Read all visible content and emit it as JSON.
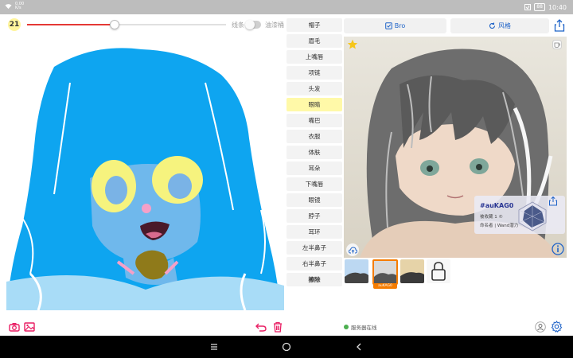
{
  "status_bar": {
    "left_line1": "0.00",
    "left_line2": "K/s",
    "battery": "88",
    "time": "10:40"
  },
  "drawing": {
    "brush_size": "21",
    "slider_fraction": 0.44,
    "slider_color": "#e53935",
    "mode_line": "线条",
    "mode_fill": "油漆桶",
    "brush_color": "#0ea5f0"
  },
  "left_toolbar": {
    "icons": [
      "camera-icon",
      "image-icon",
      "undo-icon",
      "trash-icon"
    ],
    "accent": "#e91e63"
  },
  "parts": [
    {
      "label": "帽子",
      "active": false
    },
    {
      "label": "眉毛",
      "active": false
    },
    {
      "label": "上嘴唇",
      "active": false
    },
    {
      "label": "项链",
      "active": false
    },
    {
      "label": "头发",
      "active": false
    },
    {
      "label": "眼睛",
      "active": true
    },
    {
      "label": "嘴巴",
      "active": false
    },
    {
      "label": "衣服",
      "active": false
    },
    {
      "label": "体肤",
      "active": false
    },
    {
      "label": "耳朵",
      "active": false
    },
    {
      "label": "下嘴唇",
      "active": false
    },
    {
      "label": "眼镜",
      "active": false
    },
    {
      "label": "脖子",
      "active": false
    },
    {
      "label": "耳环",
      "active": false
    },
    {
      "label": "左半鼻子",
      "active": false
    },
    {
      "label": "右半鼻子",
      "active": false
    },
    {
      "label": "擦除",
      "active": false,
      "bold": true
    }
  ],
  "right_panel": {
    "bro_label": "Bro",
    "style_label": "风格",
    "accent": "#1e63c8",
    "card": {
      "title": "#auKAG0",
      "line1": "被收藏 1 ©",
      "line2": "命名者 | Wand潜力"
    },
    "thumbnails": [
      {
        "name": "thumb-1",
        "selected": false
      },
      {
        "name": "thumb-2",
        "selected": true,
        "label": "auKAG0"
      },
      {
        "name": "thumb-3",
        "selected": false
      },
      {
        "name": "thumb-lock",
        "selected": false
      }
    ],
    "server_status": "服务器在线"
  }
}
